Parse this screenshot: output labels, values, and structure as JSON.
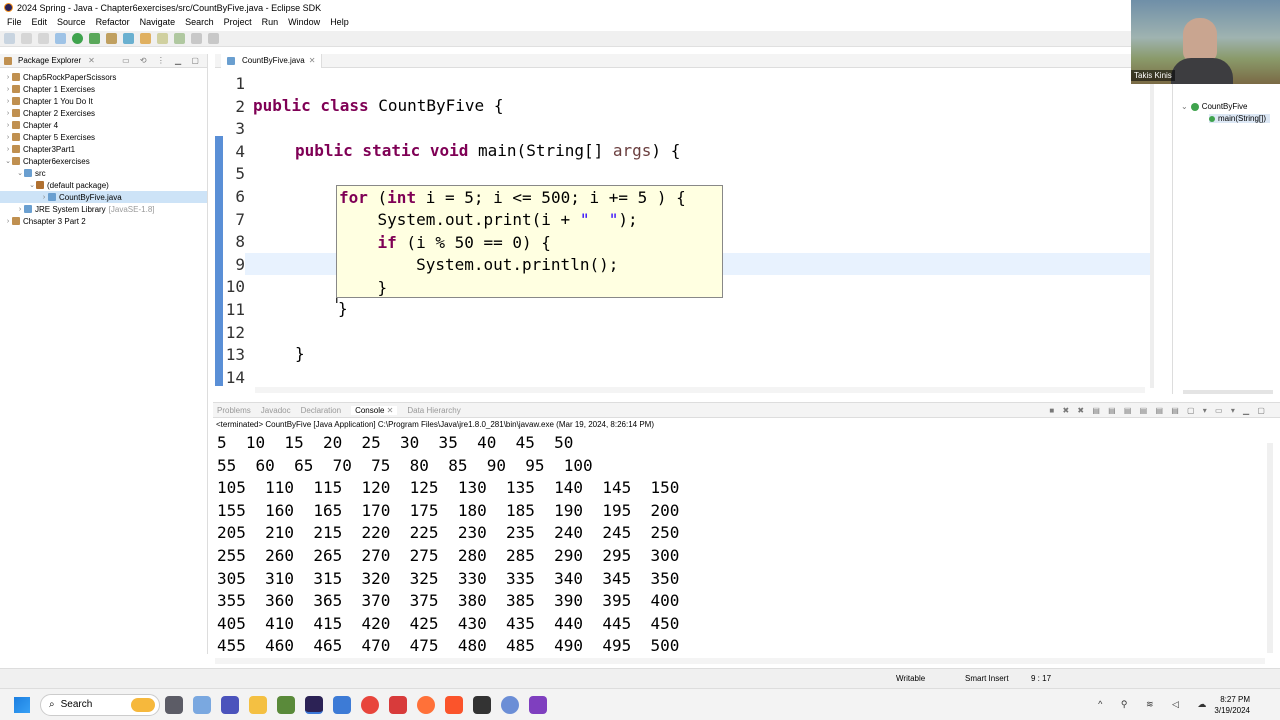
{
  "window": {
    "title": "2024 Spring - Java - Chapter6exercises/src/CountByFive.java - Eclipse SDK"
  },
  "menu": [
    "File",
    "Edit",
    "Source",
    "Refactor",
    "Navigate",
    "Search",
    "Project",
    "Run",
    "Window",
    "Help"
  ],
  "package_explorer": {
    "title": "Package Explorer",
    "items": [
      {
        "label": "Chap5RockPaperScissors",
        "depth": 0,
        "twisty": "›"
      },
      {
        "label": "Chapter 1 Exercises",
        "depth": 0,
        "twisty": "›"
      },
      {
        "label": "Chapter 1 You Do It",
        "depth": 0,
        "twisty": "›"
      },
      {
        "label": "Chapter 2 Exercises",
        "depth": 0,
        "twisty": "›"
      },
      {
        "label": "Chapter 4",
        "depth": 0,
        "twisty": "›"
      },
      {
        "label": "Chapter 5 Exercises",
        "depth": 0,
        "twisty": "›"
      },
      {
        "label": "Chapter3Part1",
        "depth": 0,
        "twisty": "›"
      },
      {
        "label": "Chapter6exercises",
        "depth": 0,
        "twisty": "⌄"
      },
      {
        "label": "src",
        "depth": 1,
        "twisty": "⌄"
      },
      {
        "label": "(default package)",
        "depth": 2,
        "twisty": "⌄"
      },
      {
        "label": "CountByFive.java",
        "depth": 3,
        "twisty": "›",
        "selected": true
      },
      {
        "label": "JRE System Library",
        "suffix": "[JavaSE-1.8]",
        "depth": 1,
        "twisty": "›"
      },
      {
        "label": "Chsapter 3 Part 2",
        "depth": 0,
        "twisty": "›"
      }
    ]
  },
  "editor": {
    "tab": "CountByFive.java",
    "line_numbers": [
      "1",
      "2",
      "3",
      "4",
      "5",
      "6",
      "7",
      "8",
      "9",
      "10",
      "11",
      "12",
      "13",
      "14"
    ],
    "lines": {
      "l2_kw": "public class",
      "l2_rest": " CountByFive {",
      "l4_kw": "public static void",
      "l4_rest": " main(String[] ",
      "l4_args": "args",
      "l4_end": ") {",
      "l11": "}",
      "l13": "}"
    },
    "popup": [
      {
        "kw": "for",
        "rest": " (",
        "kw2": "int",
        "rest2": " i = 5; i <= 500; i += 5 ) {"
      },
      {
        "pre": "    System.out.print(i + ",
        "str": "\"  \"",
        "post": ");"
      },
      {
        "pre": "    ",
        "kw": "if",
        "rest": " (i % 50 == 0) {"
      },
      {
        "pre": "        System.out.println();"
      },
      {
        "pre": "    }"
      }
    ]
  },
  "outline": {
    "class": "CountByFive",
    "method": "main(String[])"
  },
  "video": {
    "name": "Takis Kinis"
  },
  "console": {
    "tabs": [
      "Problems",
      "Javadoc",
      "Declaration",
      "Console",
      "Data Hierarchy"
    ],
    "active_tab": "Console",
    "terminated": "<terminated> CountByFive [Java Application] C:\\Program Files\\Java\\jre1.8.0_281\\bin\\javaw.exe (Mar 19, 2024, 8:26:14 PM)",
    "output": [
      "5  10  15  20  25  30  35  40  45  50",
      "55  60  65  70  75  80  85  90  95  100",
      "105  110  115  120  125  130  135  140  145  150",
      "155  160  165  170  175  180  185  190  195  200",
      "205  210  215  220  225  230  235  240  245  250",
      "255  260  265  270  275  280  285  290  295  300",
      "305  310  315  320  325  330  335  340  345  350",
      "355  360  365  370  375  380  385  390  395  400",
      "405  410  415  420  425  430  435  440  445  450",
      "455  460  465  470  475  480  485  490  495  500"
    ]
  },
  "status": {
    "writable": "Writable",
    "insert": "Smart Insert",
    "position": "9 : 17"
  },
  "taskbar": {
    "search": "Search",
    "time": "8:27 PM",
    "date": "3/19/2024"
  },
  "colors": {
    "keyword": "#7f0055",
    "string": "#2a00ff",
    "popup_bg": "#ffffe1",
    "highlight": "#e8f2fe"
  }
}
